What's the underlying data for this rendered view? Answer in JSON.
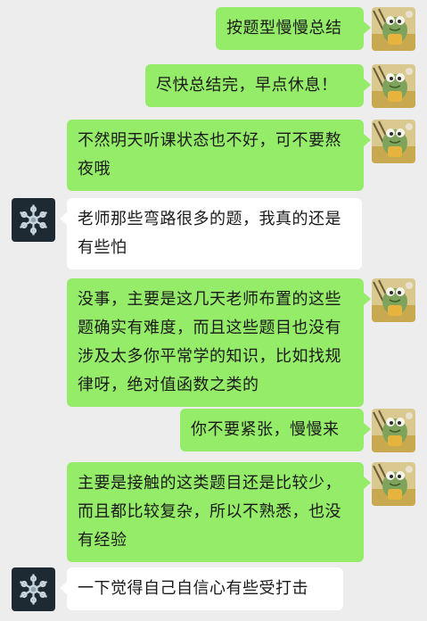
{
  "colors": {
    "background": "#ededed",
    "my_bubble": "#95ec69",
    "other_bubble": "#ffffff",
    "text": "#1a1a1a"
  },
  "avatars": {
    "me": "frog-avatar",
    "other": "snowflake-avatar"
  },
  "messages": [
    {
      "sender": "me",
      "text": "按题型慢慢总结"
    },
    {
      "sender": "me",
      "text": "尽快总结完，早点休息！"
    },
    {
      "sender": "me",
      "text": "不然明天听课状态也不好，可不要熬夜哦"
    },
    {
      "sender": "other",
      "text": "老师那些弯路很多的题，我真的还是有些怕"
    },
    {
      "sender": "me",
      "text": "没事，主要是这几天老师布置的这些题确实有难度，而且这些题目也没有涉及太多你平常学的知识，比如找规律呀，绝对值函数之类的"
    },
    {
      "sender": "me",
      "text": "你不要紧张，慢慢来"
    },
    {
      "sender": "me",
      "text": "主要是接触的这类题目还是比较少，而且都比较复杂，所以不熟悉，也没有经验"
    },
    {
      "sender": "other",
      "text": "一下觉得自己自信心有些受打击"
    }
  ]
}
